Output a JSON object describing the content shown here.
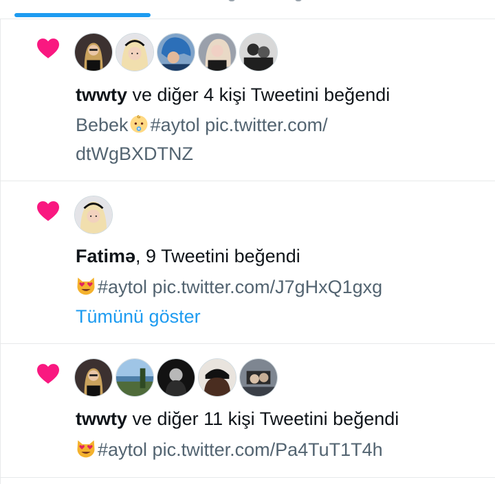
{
  "colors": {
    "accent": "#1d9bf0",
    "heart": "#f91880",
    "text": "#0f1419",
    "muted": "#536471",
    "border": "#e7e9ea"
  },
  "notifications": [
    {
      "avatars": [
        "avatar-1",
        "avatar-2",
        "avatar-3",
        "avatar-4",
        "avatar-5"
      ],
      "actor": "twwty",
      "action": " ve diğer 4 kişi Tweetini beğendi",
      "tweet_line1_text": "Bebek",
      "tweet_line1_emoji": "baby-face-emoji",
      "tweet_line1_rest": "#aytol pic.twitter.com/",
      "tweet_line2": "dtWgBXDTNZ"
    },
    {
      "avatars": [
        "avatar-2"
      ],
      "actor": "Fatimə",
      "action": ", 9 Tweetini beğendi",
      "tweet_emoji": "heart-eyes-cat-emoji",
      "tweet_text": "#aytol pic.twitter.com/J7gHxQ1gxg",
      "show_more": "Tümünü göster"
    },
    {
      "avatars": [
        "avatar-1",
        "avatar-6",
        "avatar-7",
        "avatar-8",
        "avatar-9"
      ],
      "actor": "twwty",
      "action": " ve diğer 11 kişi Tweetini beğendi",
      "tweet_emoji": "heart-eyes-cat-emoji",
      "tweet_text": "#aytol pic.twitter.com/Pa4TuT1T4h"
    }
  ]
}
